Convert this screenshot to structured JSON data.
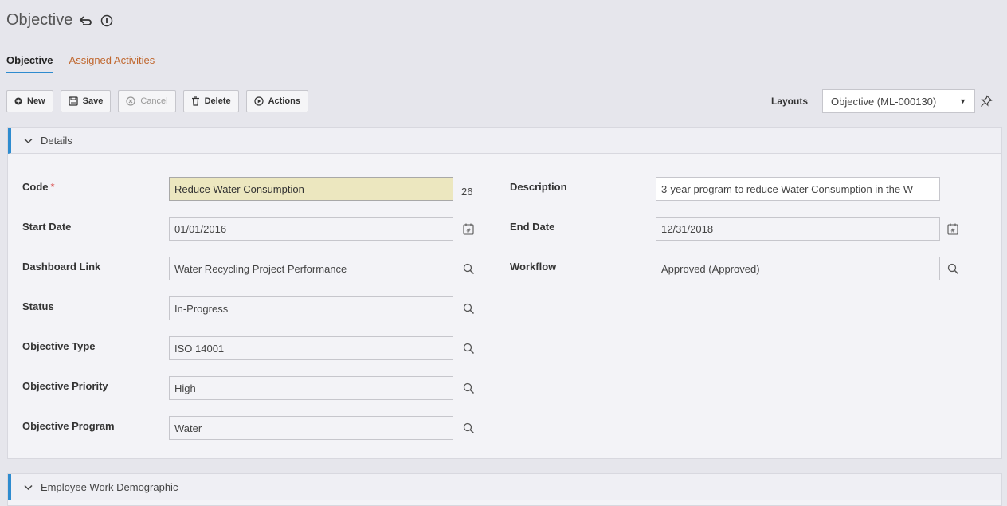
{
  "header": {
    "title": "Objective"
  },
  "tabs": [
    {
      "label": "Objective"
    },
    {
      "label": "Assigned Activities"
    }
  ],
  "toolbar": {
    "new_label": "New",
    "save_label": "Save",
    "cancel_label": "Cancel",
    "delete_label": "Delete",
    "actions_label": "Actions"
  },
  "layouts": {
    "label": "Layouts",
    "selected": "Objective (ML-000130)"
  },
  "details": {
    "title": "Details",
    "fields": {
      "code": {
        "label": "Code",
        "required_mark": "*",
        "value": "Reduce Water Consumption",
        "counter": "26"
      },
      "description": {
        "label": "Description",
        "value": "3-year program to reduce Water Consumption in the W"
      },
      "start_date": {
        "label": "Start Date",
        "value": "01/01/2016"
      },
      "end_date": {
        "label": "End Date",
        "value": "12/31/2018"
      },
      "dashboard_link": {
        "label": "Dashboard Link",
        "value": "Water Recycling Project Performance"
      },
      "workflow": {
        "label": "Workflow",
        "value": "Approved (Approved)"
      },
      "status": {
        "label": "Status",
        "value": "In-Progress"
      },
      "objective_type": {
        "label": "Objective Type",
        "value": "ISO 14001"
      },
      "objective_priority": {
        "label": "Objective Priority",
        "value": "High"
      },
      "objective_program": {
        "label": "Objective Program",
        "value": "Water"
      }
    }
  },
  "employee_section": {
    "title": "Employee Work Demographic"
  },
  "icons": {
    "accent": "#2e8bcf",
    "tab_inactive": "#c0672e",
    "required": "#d63b3b",
    "highlight_field": "#ece7bf"
  }
}
